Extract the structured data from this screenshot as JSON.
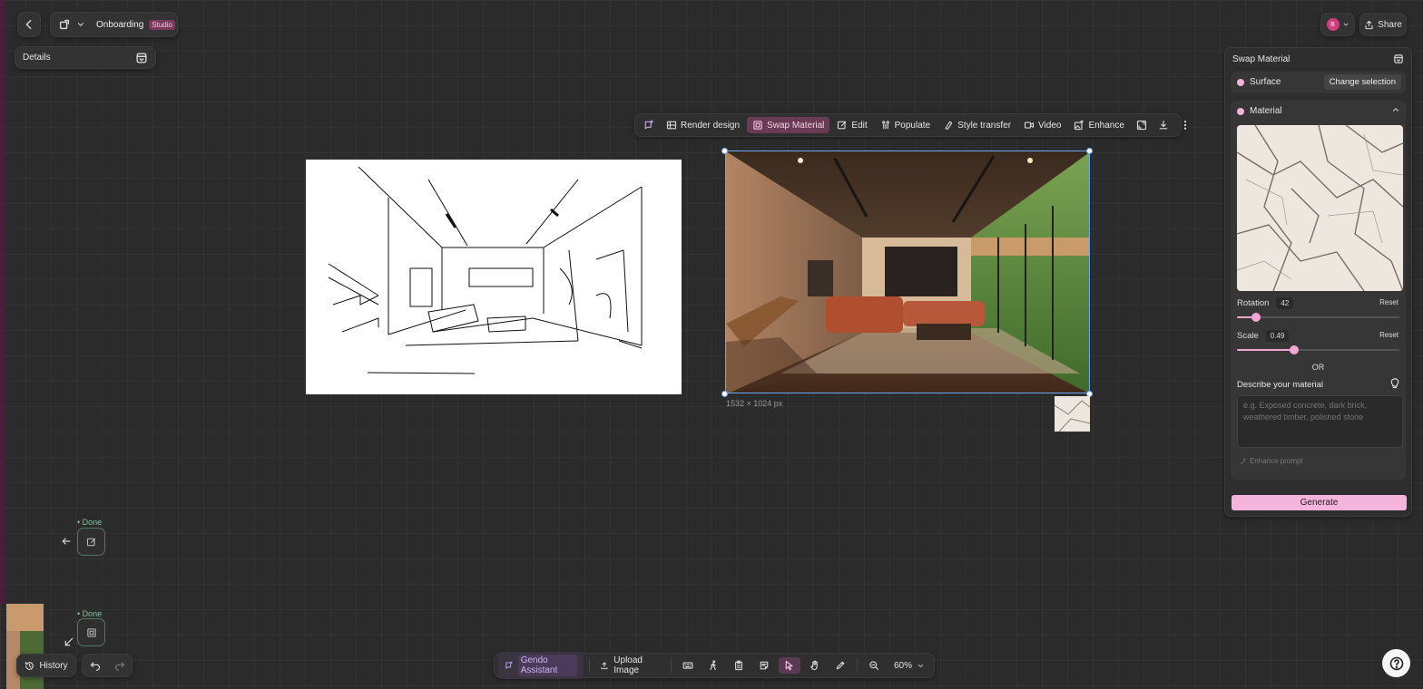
{
  "project": {
    "name": "Onboarding",
    "badge": "Studio"
  },
  "details": {
    "label": "Details"
  },
  "user": {
    "initial": "B"
  },
  "share": {
    "label": "Share"
  },
  "toolbar": {
    "render_design": "Render design",
    "swap_material": "Swap Material",
    "edit": "Edit",
    "populate": "Populate",
    "style_transfer": "Style transfer",
    "video": "Video",
    "enhance": "Enhance"
  },
  "canvas": {
    "dimensions": "1532 × 1024 px"
  },
  "swap_panel": {
    "title": "Swap Material",
    "surface_label": "Surface",
    "change_selection": "Change selection",
    "material_label": "Material",
    "rotation_label": "Rotation",
    "rotation_value": "42",
    "rotation_fraction": 0.12,
    "scale_label": "Scale",
    "scale_value": "0.49",
    "scale_fraction": 0.35,
    "reset_label": "Reset",
    "or_label": "OR",
    "describe_label": "Describe your material",
    "describe_placeholder": "e.g. Exposed concrete, dark brick, weathered timber, polished stone",
    "enhance_prompt": "Enhance prompt",
    "generate": "Generate"
  },
  "timeline": {
    "done_1": "• Done",
    "done_2": "• Done"
  },
  "bottom_left": {
    "history": "History"
  },
  "bottom_bar": {
    "assistant": "Gendo Assistant",
    "upload": "Upload Image",
    "zoom": "60%"
  },
  "colors": {
    "accent_pink": "#f5b4dc",
    "selection_blue": "#6aa8ff",
    "done_green": "#7fc6a0"
  }
}
